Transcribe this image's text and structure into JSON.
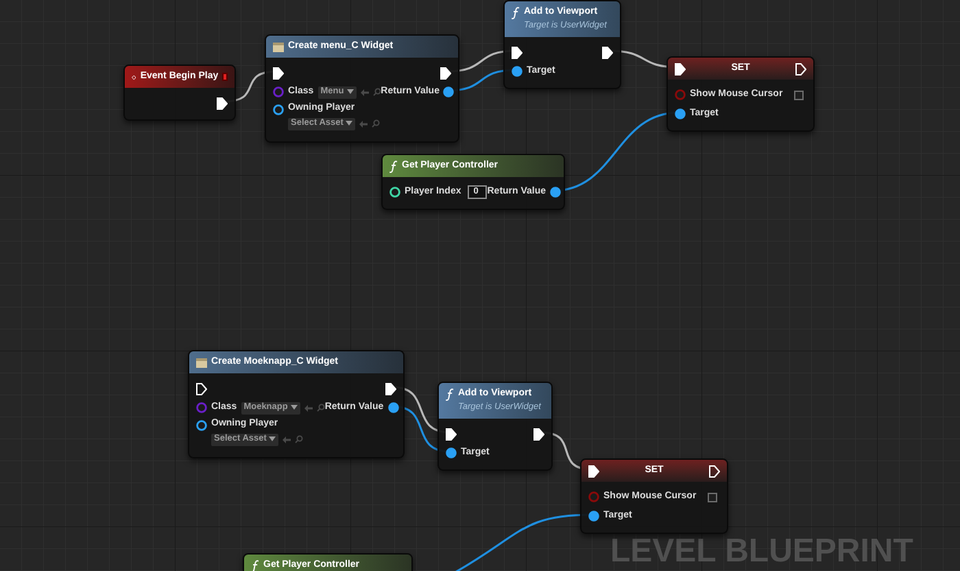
{
  "graph_label": "LEVEL BLUEPRINT",
  "nodes": [
    {
      "kind": "event",
      "title": "Event Begin Play",
      "rows": [
        {
          "right": {
            "kind": "exec",
            "connected": true
          }
        }
      ]
    },
    {
      "kind": "create_widget",
      "title": "Create menu_C Widget",
      "rows": [
        {
          "left": {
            "kind": "exec",
            "connected": true
          },
          "right": {
            "kind": "exec",
            "connected": true
          }
        },
        {
          "left": {
            "kind": "class",
            "label": "Class",
            "connected": false,
            "dropdown": "Menu"
          },
          "right": {
            "kind": "object",
            "label": "Return Value",
            "connected": true
          }
        },
        {
          "left": {
            "kind": "player",
            "label": "Owning Player",
            "connected": false,
            "dropdown": "Select Asset"
          }
        }
      ]
    },
    {
      "kind": "function",
      "title": "Add to Viewport",
      "subtitle": "Target is UserWidget",
      "rows": [
        {
          "left": {
            "kind": "exec",
            "connected": true
          },
          "right": {
            "kind": "exec",
            "connected": true
          }
        },
        {
          "left": {
            "kind": "object",
            "label": "Target",
            "connected": true
          }
        }
      ]
    },
    {
      "kind": "set",
      "title": "SET",
      "exec_in": {
        "connected": true
      },
      "exec_out": {
        "connected": false
      },
      "rows": [
        {
          "left": {
            "kind": "bool",
            "label": "Show Mouse Cursor",
            "connected": false,
            "checked": false
          }
        },
        {
          "left": {
            "kind": "object",
            "label": "Target",
            "connected": true
          }
        }
      ]
    },
    {
      "kind": "pure",
      "title": "Get Player Controller",
      "rows": [
        {
          "left": {
            "kind": "int",
            "label": "Player Index",
            "connected": false,
            "value": "0"
          },
          "right": {
            "kind": "object",
            "label": "Return Value",
            "connected": true
          }
        }
      ]
    },
    {
      "kind": "create_widget",
      "title": "Create Moeknapp_C Widget",
      "rows": [
        {
          "left": {
            "kind": "exec",
            "connected": false
          },
          "right": {
            "kind": "exec",
            "connected": true
          }
        },
        {
          "left": {
            "kind": "class",
            "label": "Class",
            "connected": false,
            "dropdown": "Moeknapp"
          },
          "right": {
            "kind": "object",
            "label": "Return Value",
            "connected": true
          }
        },
        {
          "left": {
            "kind": "player",
            "label": "Owning Player",
            "connected": false,
            "dropdown": "Select Asset"
          }
        }
      ]
    },
    {
      "kind": "function",
      "title": "Add to Viewport",
      "subtitle": "Target is UserWidget",
      "rows": [
        {
          "left": {
            "kind": "exec",
            "connected": true
          },
          "right": {
            "kind": "exec",
            "connected": true
          }
        },
        {
          "left": {
            "kind": "object",
            "label": "Target",
            "connected": true
          }
        }
      ]
    },
    {
      "kind": "set",
      "title": "SET",
      "exec_in": {
        "connected": true
      },
      "exec_out": {
        "connected": false
      },
      "rows": [
        {
          "left": {
            "kind": "bool",
            "label": "Show Mouse Cursor",
            "connected": false,
            "checked": false
          }
        },
        {
          "left": {
            "kind": "object",
            "label": "Target",
            "connected": true
          }
        }
      ]
    },
    {
      "kind": "pure",
      "title": "Get Player Controller"
    }
  ]
}
